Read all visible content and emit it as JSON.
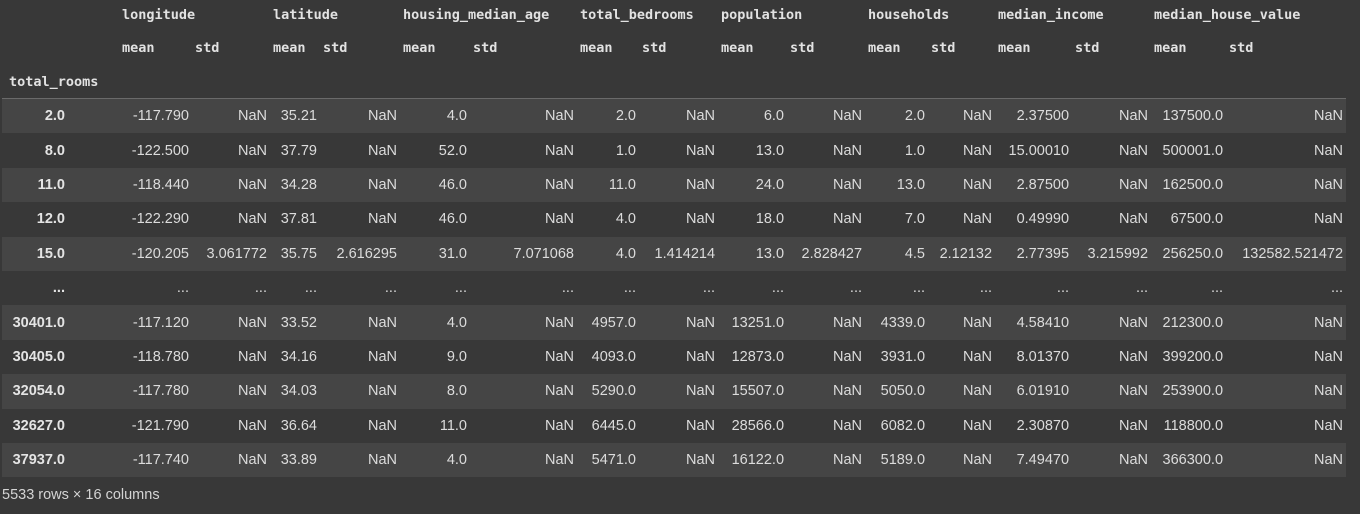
{
  "index_name": "total_rooms",
  "top_headers": [
    "longitude",
    "latitude",
    "housing_median_age",
    "total_bedrooms",
    "population",
    "households",
    "median_income",
    "median_house_value"
  ],
  "sub_headers": [
    "mean",
    "std",
    "mean",
    "std",
    "mean",
    "std",
    "mean",
    "std",
    "mean",
    "std",
    "mean",
    "std",
    "mean",
    "std",
    "mean",
    "std"
  ],
  "rows": [
    {
      "index": "2.0",
      "cells": [
        "-117.790",
        "NaN",
        "35.21",
        "NaN",
        "4.0",
        "NaN",
        "2.0",
        "NaN",
        "6.0",
        "NaN",
        "2.0",
        "NaN",
        "2.37500",
        "NaN",
        "137500.0",
        "NaN"
      ]
    },
    {
      "index": "8.0",
      "cells": [
        "-122.500",
        "NaN",
        "37.79",
        "NaN",
        "52.0",
        "NaN",
        "1.0",
        "NaN",
        "13.0",
        "NaN",
        "1.0",
        "NaN",
        "15.00010",
        "NaN",
        "500001.0",
        "NaN"
      ]
    },
    {
      "index": "11.0",
      "cells": [
        "-118.440",
        "NaN",
        "34.28",
        "NaN",
        "46.0",
        "NaN",
        "11.0",
        "NaN",
        "24.0",
        "NaN",
        "13.0",
        "NaN",
        "2.87500",
        "NaN",
        "162500.0",
        "NaN"
      ]
    },
    {
      "index": "12.0",
      "cells": [
        "-122.290",
        "NaN",
        "37.81",
        "NaN",
        "46.0",
        "NaN",
        "4.0",
        "NaN",
        "18.0",
        "NaN",
        "7.0",
        "NaN",
        "0.49990",
        "NaN",
        "67500.0",
        "NaN"
      ]
    },
    {
      "index": "15.0",
      "cells": [
        "-120.205",
        "3.061772",
        "35.75",
        "2.616295",
        "31.0",
        "7.071068",
        "4.0",
        "1.414214",
        "13.0",
        "2.828427",
        "4.5",
        "2.12132",
        "2.77395",
        "3.215992",
        "256250.0",
        "132582.521472"
      ]
    },
    {
      "index": "...",
      "cells": [
        "...",
        "...",
        "...",
        "...",
        "...",
        "...",
        "...",
        "...",
        "...",
        "...",
        "...",
        "...",
        "...",
        "...",
        "...",
        "..."
      ]
    },
    {
      "index": "30401.0",
      "cells": [
        "-117.120",
        "NaN",
        "33.52",
        "NaN",
        "4.0",
        "NaN",
        "4957.0",
        "NaN",
        "13251.0",
        "NaN",
        "4339.0",
        "NaN",
        "4.58410",
        "NaN",
        "212300.0",
        "NaN"
      ]
    },
    {
      "index": "30405.0",
      "cells": [
        "-118.780",
        "NaN",
        "34.16",
        "NaN",
        "9.0",
        "NaN",
        "4093.0",
        "NaN",
        "12873.0",
        "NaN",
        "3931.0",
        "NaN",
        "8.01370",
        "NaN",
        "399200.0",
        "NaN"
      ]
    },
    {
      "index": "32054.0",
      "cells": [
        "-117.780",
        "NaN",
        "34.03",
        "NaN",
        "8.0",
        "NaN",
        "5290.0",
        "NaN",
        "15507.0",
        "NaN",
        "5050.0",
        "NaN",
        "6.01910",
        "NaN",
        "253900.0",
        "NaN"
      ]
    },
    {
      "index": "32627.0",
      "cells": [
        "-121.790",
        "NaN",
        "36.64",
        "NaN",
        "11.0",
        "NaN",
        "6445.0",
        "NaN",
        "28566.0",
        "NaN",
        "6082.0",
        "NaN",
        "2.30870",
        "NaN",
        "118800.0",
        "NaN"
      ]
    },
    {
      "index": "37937.0",
      "cells": [
        "-117.740",
        "NaN",
        "33.89",
        "NaN",
        "4.0",
        "NaN",
        "5471.0",
        "NaN",
        "16122.0",
        "NaN",
        "5189.0",
        "NaN",
        "7.49470",
        "NaN",
        "366300.0",
        "NaN"
      ]
    }
  ],
  "footer": "5533 rows × 16 columns",
  "colors": {
    "background": "#383838",
    "row_stripe": "#454545",
    "text": "#dcdcdc"
  }
}
